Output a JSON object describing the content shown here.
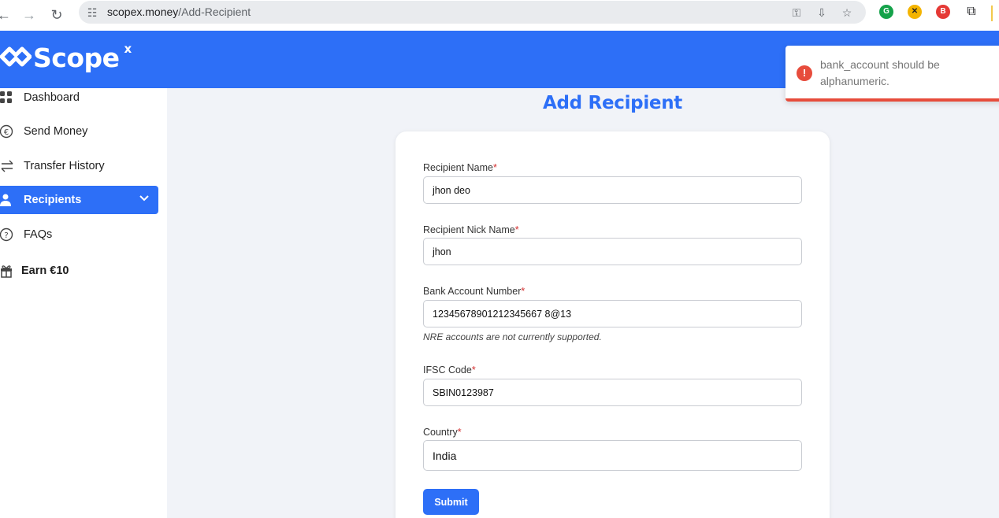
{
  "browser": {
    "url_domain": "scopex.money",
    "url_path": "/Add-Recipient"
  },
  "header": {
    "logo_text": "Scope",
    "logo_sup": "x"
  },
  "sidebar": {
    "items": [
      {
        "label": "Dashboard",
        "icon": "grid-icon"
      },
      {
        "label": "Send Money",
        "icon": "euro-icon"
      },
      {
        "label": "Transfer History",
        "icon": "transfer-icon"
      },
      {
        "label": "Recipients",
        "icon": "user-icon",
        "active": true
      },
      {
        "label": "FAQs",
        "icon": "question-icon"
      },
      {
        "label": "Earn €10",
        "icon": "gift-icon"
      }
    ]
  },
  "page": {
    "title": "Add Recipient"
  },
  "form": {
    "recipient_name": {
      "label": "Recipient Name",
      "value": "jhon deo"
    },
    "nick_name": {
      "label": "Recipient Nick Name",
      "value": "jhon"
    },
    "bank_account": {
      "label": "Bank Account Number",
      "value": "12345678901212345667 8@13",
      "hint": "NRE accounts are not currently supported."
    },
    "ifsc": {
      "label": "IFSC Code",
      "value": "SBIN0123987"
    },
    "country": {
      "label": "Country",
      "value": "India"
    },
    "required_mark": "*",
    "submit_label": "Submit"
  },
  "toast": {
    "message": "bank_account should be alphanumeric.",
    "icon": "!"
  },
  "colors": {
    "brand": "#2d6ff7",
    "error": "#e74c3c"
  }
}
